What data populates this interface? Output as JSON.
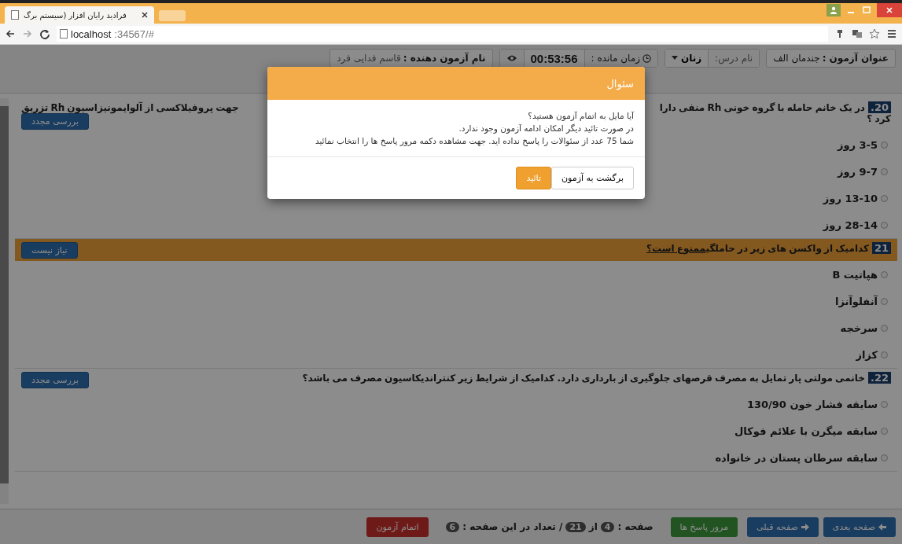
{
  "browser": {
    "tab_title": "فرادید رایان افزار (سیستم برگ",
    "address_host": "localhost",
    "address_rest": ":34567/#"
  },
  "header": {
    "exam_title_label": "عنوان آزمون :",
    "exam_title": "جندمان الف",
    "course_label": "نام درس:",
    "course": "زنان",
    "time_label": "زمان مانده :",
    "time": "00:53:56",
    "examinee_label": "نام آزمون دهنده :",
    "examinee": "قاسم فدایی فرد"
  },
  "questions": [
    {
      "number": "20.",
      "flagged": false,
      "text_start": "در یک خانم حامله با گروه خونی Rh منفی دارا",
      "text_end": "جهت پروفیلاکسی از آلوایمونیزاسیون Rh تزریق",
      "text_wrap": "کرد ؟",
      "review_button": "بررسی مجدد",
      "options": [
        {
          "label": "3-5 روز",
          "selected": false
        },
        {
          "label": "9-7 روز",
          "selected": false
        },
        {
          "label": "13-10 روز",
          "selected": false
        },
        {
          "label": "28-14 روز",
          "selected": false
        }
      ]
    },
    {
      "number": "21",
      "flagged": true,
      "text_start": "کدامیک از واکسن های زیر در حاملگی",
      "emphasis": "ممنوع است؟",
      "review_button": "نیاز نیست",
      "options": [
        {
          "label": "هپاتیت B",
          "selected": false
        },
        {
          "label": "آنفلوآنزا",
          "selected": false
        },
        {
          "label": "سرخجه",
          "selected": false
        },
        {
          "label": "کزاز",
          "selected": false
        }
      ]
    },
    {
      "number": "22.",
      "flagged": false,
      "text_start": "خانمی مولتی پار تمایل به مصرف قرصهای جلوگیری از بارداری دارد. کدامیک از شرایط زیر کنتراندیکاسیون مصرف می باشد؟",
      "review_button": "بررسی مجدد",
      "options": [
        {
          "label": "سابقه فشار خون 130/90",
          "selected": false
        },
        {
          "label": "سابقه میگرن با علائم فوکال",
          "selected": false
        },
        {
          "label": "سابقه سرطان پستان در خانواده",
          "selected": false
        }
      ]
    }
  ],
  "footer": {
    "next": "صفحه بعدی",
    "prev": "صفحه قبلی",
    "review": "مرور پاسخ ها",
    "page_label": "صفحه :",
    "page": "4",
    "of_label": "از",
    "pages": "21",
    "count_label": "/ تعداد در این صفحه :",
    "count": "6",
    "finish": "اتمام آزمون"
  },
  "modal": {
    "title": "سئوال",
    "lines": [
      "آیا مایل به اتمام آزمون هستید؟",
      "در صورت تائید دیگر امکان ادامه آزمون وجود ندارد.",
      "شما 75 عدد از سئوالات را پاسخ نداده اید. جهت مشاهده دکمه مرور پاسخ ها را انتخاب نمائید"
    ],
    "cancel": "برگشت به آزمون",
    "confirm": "تائید"
  }
}
